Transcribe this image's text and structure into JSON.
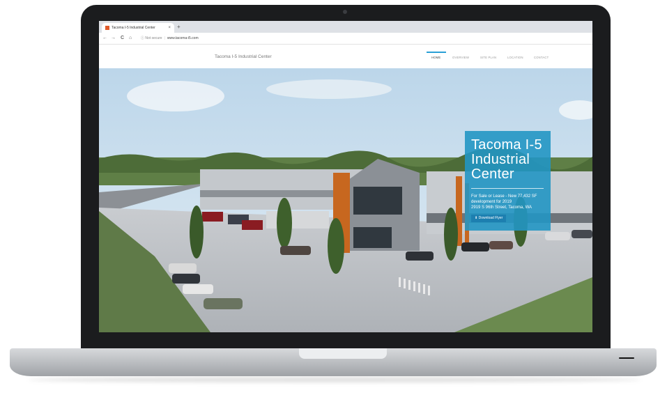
{
  "browser": {
    "tab_title": "Tacoma I-5 Industrial Center",
    "tab_close": "×",
    "new_tab": "+",
    "nav_back": "←",
    "nav_forward": "→",
    "reload": "C",
    "home": "⌂",
    "security": "ⓘ Not secure",
    "url": "www.tacoma-i5.com"
  },
  "site": {
    "title": "Tacoma I-5 Industrial Center",
    "nav": [
      {
        "label": "HOME",
        "active": true
      },
      {
        "label": "OVERVIEW"
      },
      {
        "label": "SITE PLAN"
      },
      {
        "label": "LOCATION"
      },
      {
        "label": "CONTACT"
      }
    ],
    "hero": {
      "heading": "Tacoma I-5\nIndustrial\nCenter",
      "desc_line1": "For Sale or Lease - New 77,432 SF development for 2019",
      "desc_line2": "2919 S 96th Street, Tacoma, WA",
      "download_label": "⬇ Download Flyer"
    }
  },
  "colors": {
    "accent": "#2a9fd6",
    "info_box": "#2296c3",
    "laptop_bezel": "#1b1c1e"
  }
}
